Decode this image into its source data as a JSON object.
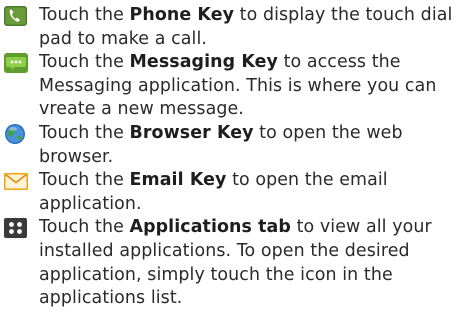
{
  "items": [
    {
      "icon": "phone-icon",
      "pre": "Touch the ",
      "bold": "Phone Key",
      "post": " to display the touch dial pad to make a call."
    },
    {
      "icon": "messaging-icon",
      "pre": "Touch the ",
      "bold": "Messaging Key",
      "post": " to access the Messaging application. This is where you can vreate a new message."
    },
    {
      "icon": "browser-icon",
      "pre": "Touch the ",
      "bold": "Browser Key",
      "post": " to open the web browser."
    },
    {
      "icon": "email-icon",
      "pre": "Touch the ",
      "bold": "Email Key",
      "post": " to open the email application."
    },
    {
      "icon": "applications-icon",
      "pre": "Touch the ",
      "bold": "Applications tab",
      "post": " to view all your installed applications. To open the desired application, simply touch the icon in the applications list."
    }
  ],
  "colors": {
    "text": "#2a2a2a",
    "phone": "#4d7a2c",
    "messaging": "#6aa832",
    "browser": "#2a6fc0",
    "email": "#f2a418",
    "applications": "#3a3a3a"
  }
}
